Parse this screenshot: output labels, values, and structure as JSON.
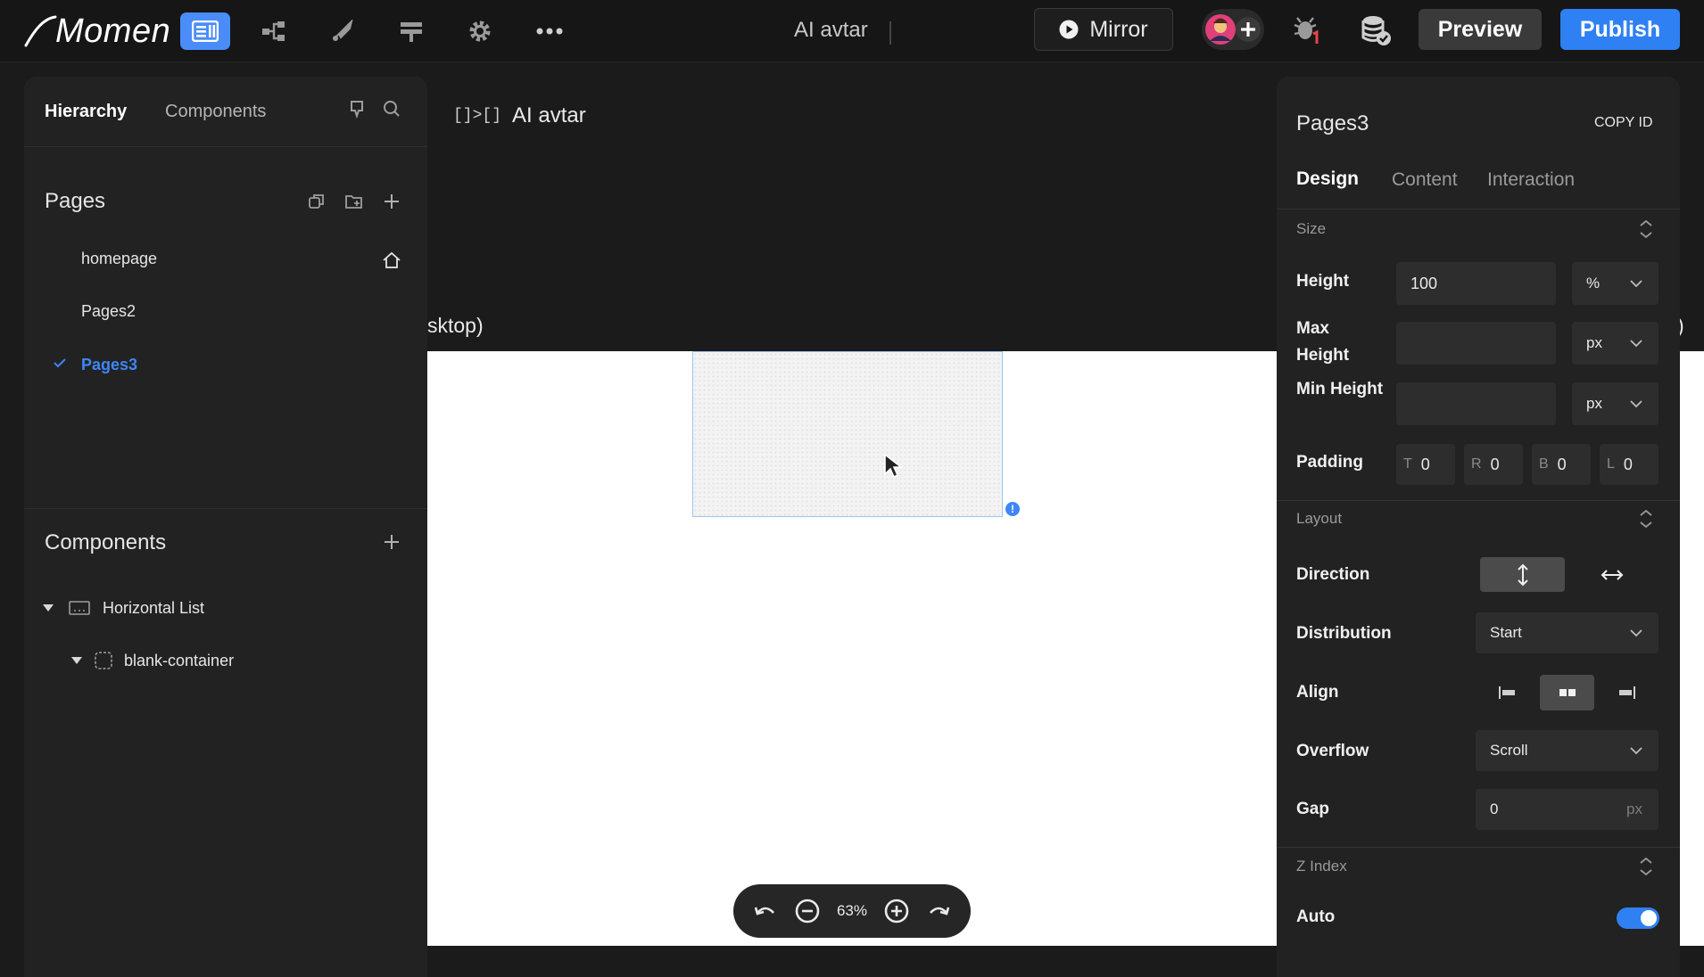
{
  "app": {
    "logo": "Momen",
    "title": "AI avtar",
    "mirror_label": "Mirror",
    "preview_label": "Preview",
    "publish_label": "Publish",
    "toolbar_icons": [
      "pages-icon",
      "data-model-icon",
      "actionflow-icon",
      "api-icon",
      "settings-icon",
      "more-icon"
    ]
  },
  "left_panel": {
    "tabs": [
      "Hierarchy",
      "Components"
    ],
    "active_tab": "Hierarchy",
    "pages_title": "Pages",
    "pages": [
      {
        "label": "homepage",
        "home": true,
        "selected": false
      },
      {
        "label": "Pages2",
        "home": false,
        "selected": false
      },
      {
        "label": "Pages3",
        "home": false,
        "selected": true
      }
    ],
    "components_title": "Components",
    "components": [
      {
        "label": "Horizontal List",
        "expanded": true,
        "depth": 0
      },
      {
        "label": "blank-container",
        "expanded": true,
        "depth": 1
      }
    ]
  },
  "canvas": {
    "breadcrumb_icon": "[]>[]",
    "breadcrumb_title": "AI avtar",
    "device_label": "sktop)",
    "right_edge_label": ")",
    "zoom": "63%"
  },
  "right_panel": {
    "title": "Pages3",
    "copy_id": "COPY ID",
    "tabs": [
      "Design",
      "Content",
      "Interaction"
    ],
    "active_tab": "Design",
    "size": {
      "header": "Size",
      "height_label": "Height",
      "height_value": "100",
      "height_unit": "%",
      "max_height_label": "Max Height",
      "max_height_unit": "px",
      "min_height_label": "Min Height",
      "min_height_unit": "px",
      "padding_label": "Padding",
      "padding": [
        {
          "side": "T",
          "value": "0"
        },
        {
          "side": "R",
          "value": "0"
        },
        {
          "side": "B",
          "value": "0"
        },
        {
          "side": "L",
          "value": "0"
        }
      ]
    },
    "layout": {
      "header": "Layout",
      "direction_label": "Direction",
      "direction_selected": "vertical",
      "distribution_label": "Distribution",
      "distribution_value": "Start",
      "align_label": "Align",
      "align_selected": "center",
      "overflow_label": "Overflow",
      "overflow_value": "Scroll",
      "gap_label": "Gap",
      "gap_value": "0",
      "gap_unit": "px"
    },
    "zindex": {
      "header": "Z Index",
      "auto_label": "Auto",
      "auto_on": true
    }
  },
  "colors": {
    "accent": "#2f80f3",
    "panel_bg": "#222222",
    "app_bg": "#1b1b1b",
    "selected_text": "#3e86f5"
  }
}
